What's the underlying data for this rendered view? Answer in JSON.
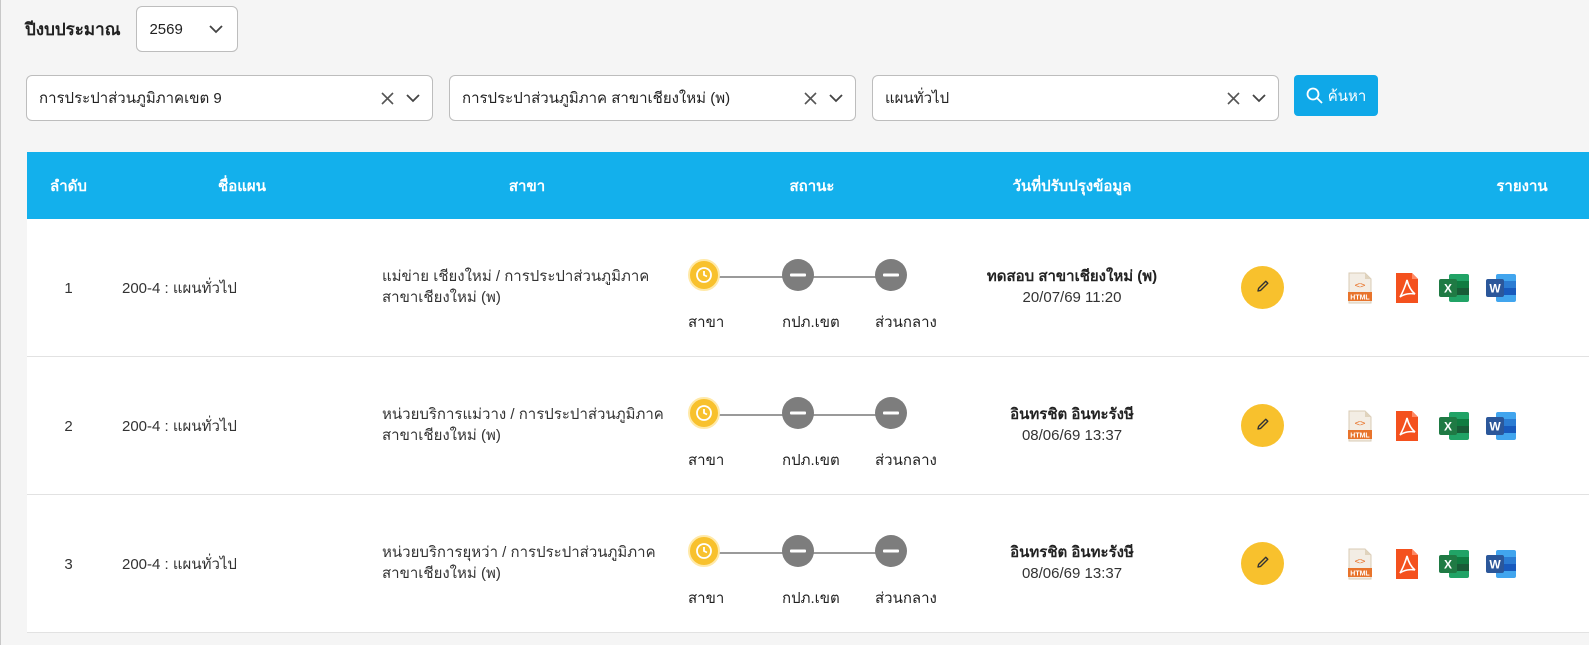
{
  "filters": {
    "year_label": "ปีงบประมาณ",
    "year_value": "2569",
    "region_value": "การประปาส่วนภูมิภาคเขต 9",
    "branch_value": "การประปาส่วนภูมิภาค สาขาเชียงใหม่ (พ)",
    "plan_value": "แผนทั่วไป",
    "search_label": "ค้นหา"
  },
  "table": {
    "headers": {
      "no": "ลำดับ",
      "plan": "ชื่อแผน",
      "branch": "สาขา",
      "status": "สถานะ",
      "updated": "วันที่ปรับปรุงข้อมูล",
      "report": "รายงาน"
    },
    "step_labels": [
      "สาขา",
      "กปภ.เขต",
      "ส่วนกลาง"
    ],
    "rows": [
      {
        "no": "1",
        "plan": "200-4 : แผนทั่วไป",
        "branch_line1": "แม่ข่าย เชียงใหม่ / การประปาส่วนภูมิภาค",
        "branch_line2": "สาขาเชียงใหม่ (พ)",
        "steps": [
          "pending",
          "none",
          "none"
        ],
        "updated_by": "ทดสอบ สาขาเชียงใหม่ (พ)",
        "updated_at": "20/07/69 11:20"
      },
      {
        "no": "2",
        "plan": "200-4 : แผนทั่วไป",
        "branch_line1": "หน่วยบริการแม่วาง / การประปาส่วนภูมิภาค",
        "branch_line2": "สาขาเชียงใหม่ (พ)",
        "steps": [
          "pending",
          "none",
          "none"
        ],
        "updated_by": "อินทรชิต อินทะรังษี",
        "updated_at": "08/06/69 13:37"
      },
      {
        "no": "3",
        "plan": "200-4 : แผนทั่วไป",
        "branch_line1": "หน่วยบริการยุหว่า / การประปาส่วนภูมิภาค",
        "branch_line2": "สาขาเชียงใหม่ (พ)",
        "steps": [
          "pending",
          "none",
          "none"
        ],
        "updated_by": "อินทรชิต อินทะรังษี",
        "updated_at": "08/06/69 13:37"
      }
    ],
    "report_icons": [
      {
        "name": "html-report-icon",
        "text": "HTML",
        "color": "#e8742c"
      },
      {
        "name": "pdf-report-icon",
        "text": "PDF",
        "color": "#f4511e"
      },
      {
        "name": "excel-report-icon",
        "text": "X",
        "color": "#1f7a44"
      },
      {
        "name": "word-report-icon",
        "text": "W",
        "color": "#2b579a"
      }
    ],
    "colors": {
      "header_bg": "#13b0ec",
      "pending": "#f8c12d",
      "inactive": "#7d7d7d"
    }
  }
}
